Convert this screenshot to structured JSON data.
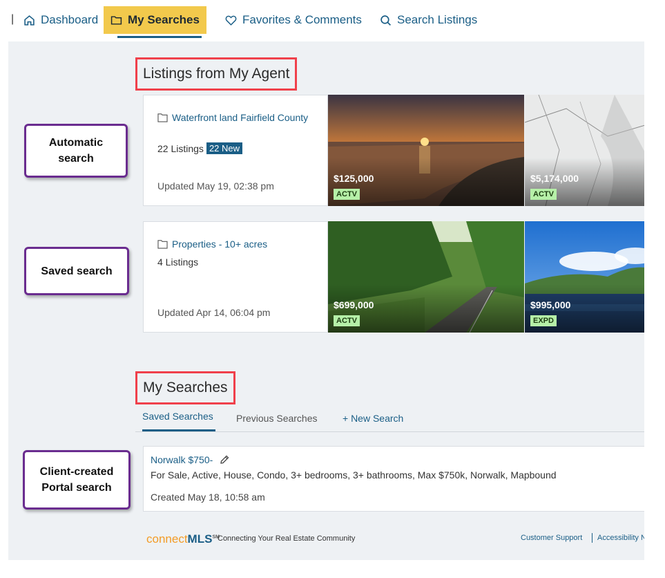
{
  "nav": {
    "separator": "|",
    "items": [
      {
        "label": "Dashboard",
        "icon": "home-icon"
      },
      {
        "label": "My Searches",
        "icon": "folder-icon",
        "active": true
      },
      {
        "label": "Favorites & Comments",
        "icon": "heart-icon"
      },
      {
        "label": "Search Listings",
        "icon": "search-icon"
      }
    ]
  },
  "agent_listings": {
    "heading": "Listings from My Agent",
    "cards": [
      {
        "title": "Waterfront land Fairfield County",
        "listings": "22 Listings",
        "new_badge": "22 New",
        "updated": "Updated May 19, 02:38 pm",
        "photos": [
          {
            "price": "$125,000",
            "status": "ACTV"
          },
          {
            "price": "$5,174,000",
            "status": "ACTV"
          }
        ]
      },
      {
        "title": "Properties - 10+ acres",
        "listings": "4 Listings",
        "updated": "Updated Apr 14, 06:04 pm",
        "photos": [
          {
            "price": "$699,000",
            "status": "ACTV"
          },
          {
            "price": "$995,000",
            "status": "EXPD"
          }
        ]
      }
    ]
  },
  "callouts": {
    "automatic": [
      "Automatic",
      "search"
    ],
    "saved": [
      "Saved search"
    ],
    "client": [
      "Client-created",
      "Portal search"
    ]
  },
  "my_searches": {
    "heading": "My Searches",
    "tabs": [
      "Saved Searches",
      "Previous Searches",
      "+ New Search"
    ],
    "search": {
      "name": "Norwalk $750-",
      "criteria": "For Sale, Active, House, Condo, 3+ bedrooms, 3+ bathrooms, Max $750k, Norwalk, Mapbound",
      "created": "Created May 18, 10:58 am"
    }
  },
  "footer": {
    "logo_part1": "connect",
    "logo_part2": "MLS",
    "logo_tm": "SM",
    "tagline": "Connecting Your Real Estate Community",
    "links": [
      "Customer Support",
      "Accessibility N"
    ]
  },
  "colors": {
    "accent": "#1a5e86",
    "active_nav": "#f2c94c",
    "annotation_red": "#f0404b",
    "annotation_purple": "#6a2c8f",
    "status_green": "#b6f0a8"
  }
}
